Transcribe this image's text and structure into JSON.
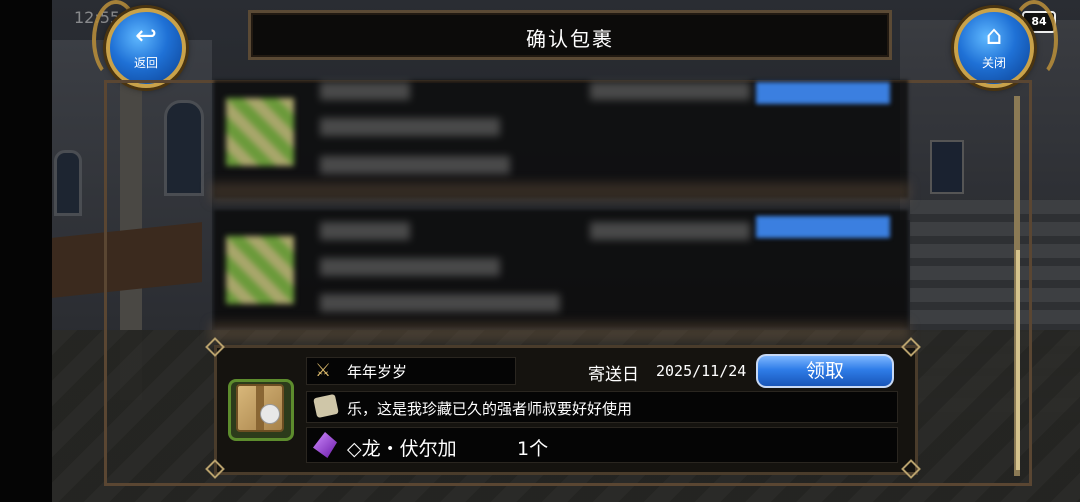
{
  "status": {
    "time": "12:55",
    "battery": "84"
  },
  "back_button": {
    "label": "返回"
  },
  "close_button": {
    "label": "关闭"
  },
  "title": "确认包裹",
  "mail": {
    "sender": "年年岁岁",
    "date_label": "寄送日",
    "date": "2025/11/24",
    "claim_label": "领取",
    "message": "乐，这是我珍藏已久的强者师叔要好好使用",
    "reward_name": "◇龙・伏尔加",
    "reward_qty": "1个"
  },
  "icons": {
    "back": "back-arrow-icon",
    "close": "home-icon",
    "sender": "crossed-swords-icon",
    "message": "scroll-icon",
    "reward": "crystal-icon",
    "item": "cardboard-box-icon"
  }
}
